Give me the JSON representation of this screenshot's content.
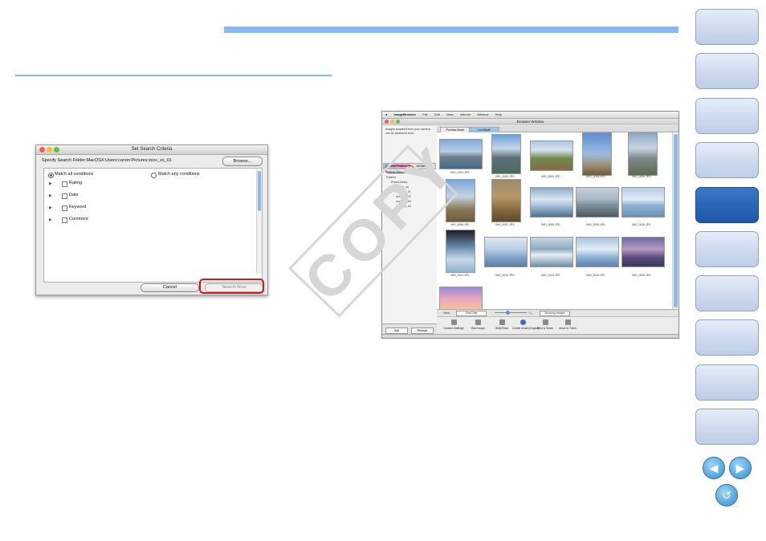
{
  "dialog": {
    "title": "Set Search Criteria",
    "folder_label": "Specify Search Folder:MacOSX:Users:canon:Pictures:xxxx_xx_01",
    "browse_label": "Browse...",
    "match_all_label": "Match all conditions",
    "match_any_label": "Match any conditions",
    "criteria": [
      "Rating",
      "Date",
      "Keyword",
      "Comment"
    ],
    "cancel_label": "Cancel",
    "search_now_label": "Search Now"
  },
  "browser": {
    "menu": [
      "ImageBrowser",
      "File",
      "Edit",
      "View",
      "Internet",
      "Window",
      "Help"
    ],
    "window_title": "Browser Window",
    "side_note": "Images acquired from your camera can be accessed here.",
    "side_tabs": [
      "Favorite Folders",
      "All folders"
    ],
    "tree": [
      "Search Results",
      "Folders",
      "PhotoLibrary",
      "canon_nd_ud",
      "xxxx_xx_01",
      "xxxx_xx_02",
      "xxxx_xx_03",
      "xxxx_xx_04",
      "Movies"
    ],
    "side_footer": [
      "Add",
      "Remove"
    ],
    "view_tabs": [
      "Preview Mode",
      "List Mode"
    ],
    "thumb_captions": [
      "IMG_0001.JPG",
      "IMG_0002.JPG",
      "IMG_0003.JPG",
      "IMG_0004.JPG",
      "IMG_0005.JPG",
      "IMG_0006.JPG",
      "IMG_0007.JPG",
      "IMG_0008.JPG",
      "IMG_0009.JPG",
      "IMG_0010.JPG",
      "IMG_0011.JPG",
      "IMG_0012.JPG",
      "IMG_0013.JPG",
      "IMG_0014.JPG",
      "IMG_0015.JPG",
      "IMG_0016.JPG"
    ],
    "view_label": "View",
    "sort_label": "Shot Date",
    "display_label": "Shooting Images",
    "tools": [
      "Camera Settings",
      "View Image",
      "SlideShow",
      "Create email (Original)",
      "Print & Share",
      "Move to Trash"
    ]
  },
  "watermark": "COPY",
  "nav": {
    "tab_count": 10,
    "active_index": 4,
    "prev_glyph": "◀",
    "next_glyph": "▶",
    "back_glyph": "↺"
  }
}
